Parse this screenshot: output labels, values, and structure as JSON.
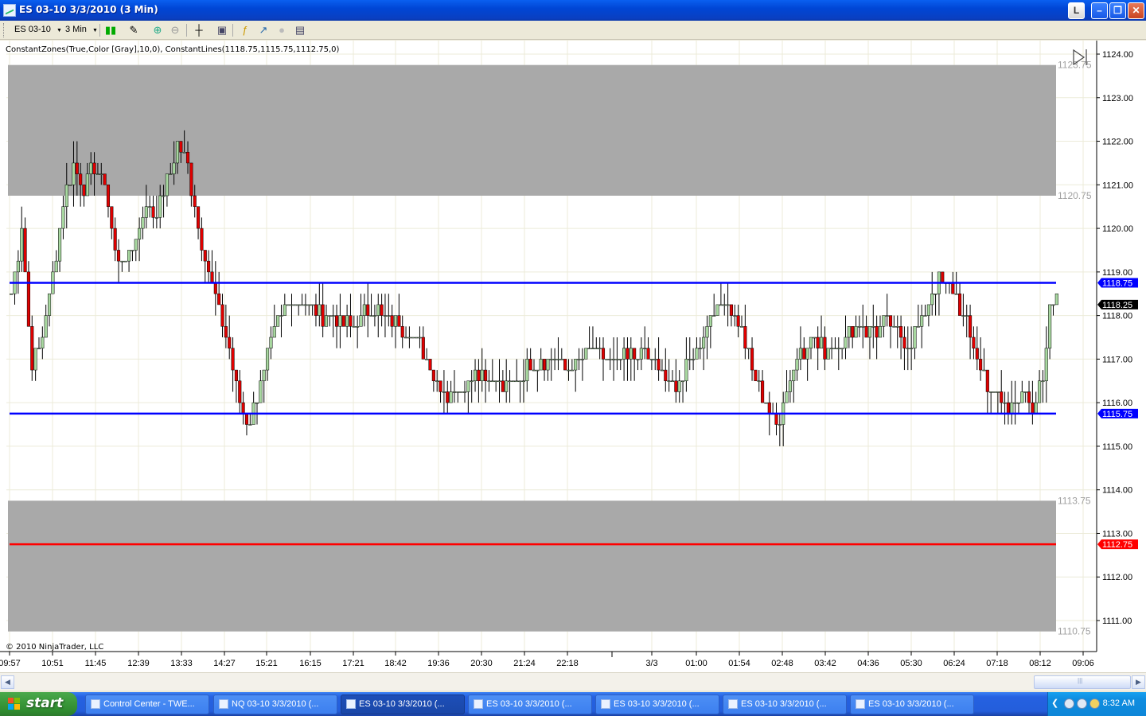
{
  "window": {
    "title": "ES 03-10  3/3/2010 (3 Min)",
    "buttons": [
      "L",
      "–",
      "❐",
      "✕"
    ]
  },
  "toolbar": {
    "instrument": "ES 03-10",
    "interval": "3 Min"
  },
  "chart": {
    "indicator_label": "ConstantZones(True,Color [Gray],10,0), ConstantLines(1118.75,1115.75,1112.75,0)",
    "copyright": "© 2010 NinjaTrader, LLC",
    "price_labels": [
      "1124.00",
      "1123.00",
      "1122.00",
      "1121.00",
      "1120.00",
      "1119.00",
      "1118.00",
      "1117.00",
      "1116.00",
      "1115.00",
      "1114.00",
      "1113.00",
      "1112.00",
      "1111.00"
    ],
    "zone_labels": [
      "1123.75",
      "1120.75",
      "1113.75",
      "1110.75"
    ],
    "line_markers": [
      {
        "text": "1118.75",
        "color": "#0000ff"
      },
      {
        "text": "1118.25",
        "color": "#000000"
      },
      {
        "text": "1115.75",
        "color": "#0000ff"
      },
      {
        "text": "1112.75",
        "color": "#ff0000"
      }
    ],
    "time_labels": [
      "09:57",
      "10:51",
      "11:45",
      "12:39",
      "13:33",
      "14:27",
      "15:21",
      "16:15",
      "17:21",
      "18:42",
      "19:36",
      "20:30",
      "21:24",
      "22:18",
      "3/3",
      "01:00",
      "01:54",
      "02:48",
      "03:42",
      "04:36",
      "05:30",
      "06:24",
      "07:18",
      "08:12",
      "09:06"
    ],
    "colors": {
      "up": "#a8d8a0",
      "down": "#e00000",
      "zone": "#a9a9a9",
      "blue_line": "#0000ff",
      "red_line": "#ff0000"
    }
  },
  "chart_data": {
    "type": "candlestick",
    "ylim": [
      1110.5,
      1124.25
    ],
    "zones": [
      [
        1120.75,
        1123.75
      ],
      [
        1110.75,
        1113.75
      ]
    ],
    "lines": [
      1118.75,
      1115.75,
      1112.75
    ],
    "last_price": 1118.25,
    "path": [
      [
        0,
        1118.5
      ],
      [
        3,
        1120.0
      ],
      [
        6,
        1116.8
      ],
      [
        9,
        1117.5
      ],
      [
        12,
        1119.0
      ],
      [
        15,
        1120.5
      ],
      [
        18,
        1121.5
      ],
      [
        21,
        1121.0
      ],
      [
        24,
        1121.5
      ],
      [
        27,
        1121.0
      ],
      [
        30,
        1119.5
      ],
      [
        33,
        1119.2
      ],
      [
        36,
        1119.8
      ],
      [
        39,
        1120.5
      ],
      [
        42,
        1120.3
      ],
      [
        45,
        1121.0
      ],
      [
        48,
        1122.0
      ],
      [
        51,
        1121.5
      ],
      [
        54,
        1120.0
      ],
      [
        57,
        1119.0
      ],
      [
        60,
        1118.0
      ],
      [
        63,
        1117.2
      ],
      [
        66,
        1116.0
      ],
      [
        69,
        1115.5
      ],
      [
        72,
        1116.5
      ],
      [
        75,
        1117.3
      ],
      [
        78,
        1118.0
      ],
      [
        81,
        1118.4
      ],
      [
        84,
        1118.4
      ],
      [
        87,
        1118.2
      ],
      [
        90,
        1117.9
      ],
      [
        94,
        1118.0
      ],
      [
        98,
        1117.7
      ],
      [
        102,
        1118.0
      ],
      [
        106,
        1118.1
      ],
      [
        110,
        1117.8
      ],
      [
        114,
        1117.7
      ],
      [
        118,
        1117.4
      ],
      [
        122,
        1116.7
      ],
      [
        126,
        1116.2
      ],
      [
        130,
        1116.3
      ],
      [
        134,
        1116.8
      ],
      [
        138,
        1116.6
      ],
      [
        142,
        1116.3
      ],
      [
        146,
        1116.6
      ],
      [
        150,
        1116.8
      ],
      [
        154,
        1117.0
      ],
      [
        158,
        1116.9
      ],
      [
        162,
        1116.8
      ],
      [
        166,
        1117.1
      ],
      [
        170,
        1117.2
      ],
      [
        174,
        1116.9
      ],
      [
        178,
        1117.0
      ],
      [
        182,
        1117.2
      ],
      [
        186,
        1116.9
      ],
      [
        190,
        1116.4
      ],
      [
        194,
        1116.6
      ],
      [
        198,
        1117.3
      ],
      [
        202,
        1118.0
      ],
      [
        206,
        1118.4
      ],
      [
        210,
        1117.8
      ],
      [
        214,
        1116.8
      ],
      [
        218,
        1116.0
      ],
      [
        221,
        1115.4
      ],
      [
        224,
        1116.3
      ],
      [
        228,
        1117.2
      ],
      [
        232,
        1117.4
      ],
      [
        236,
        1117.2
      ],
      [
        240,
        1117.4
      ],
      [
        244,
        1117.8
      ],
      [
        248,
        1117.6
      ],
      [
        252,
        1117.8
      ],
      [
        256,
        1117.6
      ],
      [
        260,
        1117.4
      ],
      [
        264,
        1118.1
      ],
      [
        268,
        1118.8
      ],
      [
        272,
        1118.7
      ],
      [
        276,
        1117.8
      ],
      [
        280,
        1116.8
      ],
      [
        284,
        1116.2
      ],
      [
        288,
        1115.8
      ],
      [
        292,
        1116.3
      ],
      [
        295,
        1115.7
      ],
      [
        298,
        1116.6
      ],
      [
        300,
        1118.0
      ],
      [
        302,
        1118.4
      ]
    ]
  }
}
